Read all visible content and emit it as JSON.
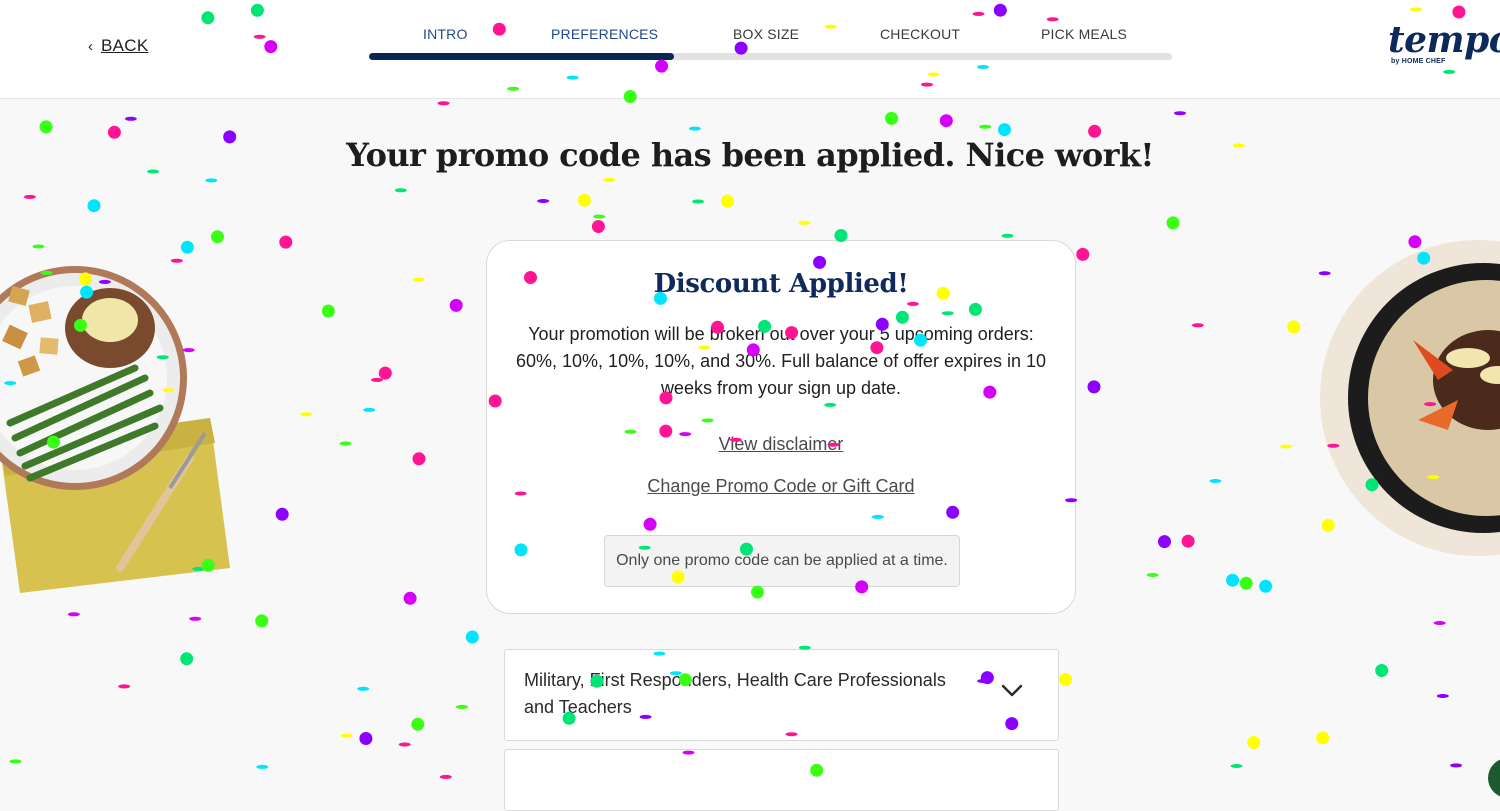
{
  "header": {
    "back_label": "BACK",
    "steps": [
      {
        "label": "INTRO",
        "active": true
      },
      {
        "label": "PREFERENCES",
        "active": true
      },
      {
        "label": "BOX SIZE",
        "active": false
      },
      {
        "label": "CHECKOUT",
        "active": false
      },
      {
        "label": "PICK MEALS",
        "active": false
      }
    ],
    "progress": 0.38,
    "logo": {
      "word": "tempo",
      "sub": "by HOME CHEF"
    }
  },
  "headline": "Your promo code has been applied. Nice work!",
  "card": {
    "title": "Discount Applied!",
    "body": "Your promotion will be broken out over your 5 upcoming orders: 60%, 10%, 10%, 10%, and 30%. Full balance of offer expires in 10 weeks from your sign up date.",
    "disclaimer_link": "View disclaimer",
    "change_link": "Change Promo Code or Gift Card",
    "note": "Only one promo code can be applied at a time."
  },
  "accordion": {
    "label": "Military, First Responders, Health Care Professionals and Teachers"
  },
  "colors": {
    "navy": "#0b2655",
    "confetti": [
      "#ff1493",
      "#8b00ff",
      "#ffff00",
      "#00e5ff",
      "#39ff14",
      "#00e676",
      "#d500f9"
    ]
  }
}
